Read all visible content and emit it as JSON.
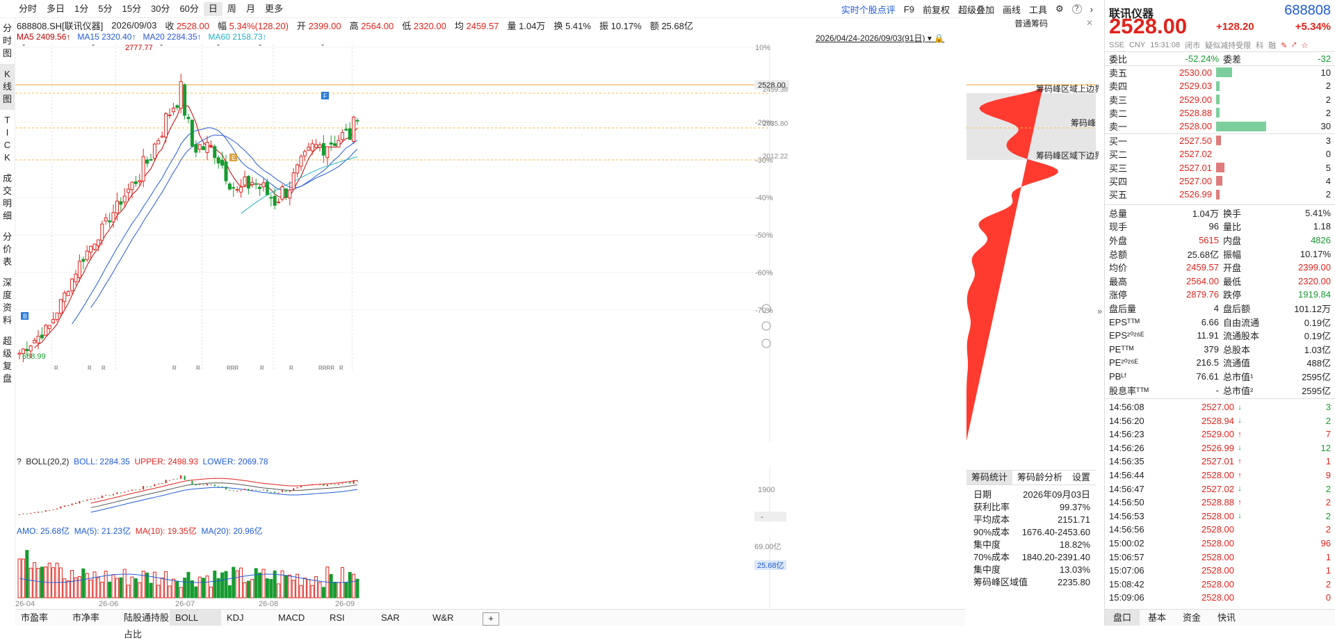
{
  "periods": [
    "分时",
    "多日",
    "1分",
    "5分",
    "15分",
    "30分",
    "60分",
    "日",
    "周",
    "月",
    "更多"
  ],
  "active_period": "日",
  "toolbar_right": {
    "rating": "实时个股点评",
    "f9": "F9",
    "adjust": "前复权",
    "overlay": "超级叠加",
    "draw": "画线",
    "tools": "工具"
  },
  "info": {
    "code_name": "688808.SH[联讯仪器]",
    "date": "2026/09/03",
    "close_label": "收",
    "close": "2528.00",
    "change_label": "幅",
    "change": "5.34%(128.20)",
    "open_label": "开",
    "open": "2399.00",
    "high_label": "高",
    "high": "2564.00",
    "low_label": "低",
    "low": "2320.00",
    "avg_label": "均",
    "avg": "2459.57",
    "vol_label": "量",
    "vol": "1.04万",
    "turn_label": "换",
    "turn": "5.41%",
    "amp_label": "振",
    "amp": "10.17%",
    "amt_label": "额",
    "amt": "25.68亿"
  },
  "ma": {
    "ma5": "MA5 2409.56↑",
    "ma15": "MA15 2320.40↑",
    "ma20": "MA20 2284.35↑",
    "ma60": "MA60 2158.73↑"
  },
  "date_range": "2026/04/24-2026/09/03(91日)",
  "vmenu": [
    {
      "label": "分\n时\n图"
    },
    {
      "label": "K\n线\n图"
    },
    {
      "label": "T\nI\nC\nK"
    },
    {
      "label": "成\n交\n明\n细"
    },
    {
      "label": "分\n价\n表"
    },
    {
      "label": "深\n度\n资\n料"
    },
    {
      "label": "超\n级\n复\n盘"
    }
  ],
  "axis": {
    "pct": [
      "10%",
      "-10%",
      "-20%",
      "-30%",
      "-40%",
      "-50%",
      "-60%",
      "-70%"
    ],
    "price_tag": "2528.00",
    "p1": "2459.38",
    "p2": "2035.80",
    "p3": "2012.22",
    "boll_tick": "1900",
    "boll_dash": "-",
    "vol_tick": "69.00亿",
    "vol_tag": "25.68亿",
    "months": [
      "26-04",
      "26-06",
      "26-07",
      "26-08",
      "26-09"
    ]
  },
  "annotations": {
    "high": "2777.77",
    "low": "688.99",
    "marker_b": "B",
    "marker_f": "F",
    "marker_e": "E",
    "r": "R",
    "rrr": "RRR",
    "rrrr": "RRRR"
  },
  "boll": {
    "title": "BOLL(20,2)",
    "boll": "BOLL: 2284.35",
    "upper": "UPPER: 2498.93",
    "lower": "LOWER: 2069.78",
    "q": "?"
  },
  "amo": {
    "amo": "AMO: 25.68亿",
    "ma5": "MA(5): 21.23亿",
    "ma10": "MA(10): 19.35亿",
    "ma20": "MA(20): 20.96亿"
  },
  "bottom_tabs": [
    "市盈率",
    "市净率",
    "陆股通持股占比",
    "BOLL",
    "KDJ",
    "MACD",
    "RSI",
    "SAR",
    "W&R",
    "+"
  ],
  "active_bottom_tab": "BOLL",
  "chip": {
    "header": "普通筹码",
    "upper": "筹码峰区域上边界",
    "peak": "筹码峰",
    "lower": "筹码峰区域下边界",
    "tabs": [
      "筹码统计",
      "筹码龄分析",
      "设置"
    ],
    "stats": [
      {
        "k": "日期",
        "v": "2026年09月03日"
      },
      {
        "k": "获利比率",
        "v": "99.37%"
      },
      {
        "k": "平均成本",
        "v": "2151.71"
      },
      {
        "k": "90%成本",
        "v": "1676.40-2453.60"
      },
      {
        "k": "集中度",
        "v": "18.82%"
      },
      {
        "k": "70%成本",
        "v": "1840.20-2391.40"
      },
      {
        "k": "集中度",
        "v": "13.03%"
      },
      {
        "k": "筹码峰区域值",
        "v": "2235.80"
      }
    ]
  },
  "quote": {
    "name": "联讯仪器",
    "code": "688808",
    "price": "2528.00",
    "change": "+128.20",
    "pct": "+5.34%",
    "sub": [
      "SSE",
      "CNY",
      "15:31:08",
      "闭市",
      "疑似减持受限",
      "科",
      "融"
    ],
    "wb": {
      "l1": "委比",
      "v1": "-52.24%",
      "l2": "委差",
      "v2": "-32"
    },
    "asks": [
      {
        "lab": "卖五",
        "p": "2530.00",
        "q": "10",
        "w": 0.18
      },
      {
        "lab": "卖四",
        "p": "2529.03",
        "q": "2",
        "w": 0.04
      },
      {
        "lab": "卖三",
        "p": "2529.00",
        "q": "2",
        "w": 0.04
      },
      {
        "lab": "卖二",
        "p": "2528.88",
        "q": "2",
        "w": 0.04
      },
      {
        "lab": "卖一",
        "p": "2528.00",
        "q": "30",
        "w": 0.55
      }
    ],
    "bids": [
      {
        "lab": "买一",
        "p": "2527.50",
        "q": "3",
        "w": 0.05
      },
      {
        "lab": "买二",
        "p": "2527.02",
        "q": "0",
        "w": 0.0
      },
      {
        "lab": "买三",
        "p": "2527.01",
        "q": "5",
        "w": 0.09
      },
      {
        "lab": "买四",
        "p": "2527.00",
        "q": "4",
        "w": 0.07
      },
      {
        "lab": "买五",
        "p": "2526.99",
        "q": "2",
        "w": 0.04
      }
    ],
    "stats": [
      {
        "l1": "总量",
        "v1": "1.04万",
        "c1": "",
        "l2": "换手",
        "v2": "5.41%",
        "c2": ""
      },
      {
        "l1": "现手",
        "v1": "96",
        "c1": "",
        "l2": "量比",
        "v2": "1.18",
        "c2": ""
      },
      {
        "l1": "外盘",
        "v1": "5615",
        "c1": "red",
        "l2": "内盘",
        "v2": "4826",
        "c2": "green"
      },
      {
        "l1": "总额",
        "v1": "25.68亿",
        "c1": "",
        "l2": "振幅",
        "v2": "10.17%",
        "c2": ""
      },
      {
        "l1": "均价",
        "v1": "2459.57",
        "c1": "red",
        "l2": "开盘",
        "v2": "2399.00",
        "c2": "red"
      },
      {
        "l1": "最高",
        "v1": "2564.00",
        "c1": "red",
        "l2": "最低",
        "v2": "2320.00",
        "c2": "red"
      },
      {
        "l1": "涨停",
        "v1": "2879.76",
        "c1": "red",
        "l2": "跌停",
        "v2": "1919.84",
        "c2": "green"
      },
      {
        "l1": "盘后量",
        "v1": "4",
        "c1": "",
        "l2": "盘后额",
        "v2": "101.12万",
        "c2": ""
      },
      {
        "l1": "EPSᵀᵀᴹ",
        "v1": "6.66",
        "c1": "",
        "l2": "自由流通",
        "v2": "0.19亿",
        "c2": ""
      },
      {
        "l1": "EPS²⁰²⁶ᴱ",
        "v1": "11.91",
        "c1": "",
        "l2": "流通股本",
        "v2": "0.19亿",
        "c2": ""
      },
      {
        "l1": "PEᵀᵀᴹ",
        "v1": "379",
        "c1": "",
        "l2": "总股本",
        "v2": "1.03亿",
        "c2": ""
      },
      {
        "l1": "PE²⁰²⁶ᴱ",
        "v1": "216.5",
        "c1": "",
        "l2": "流通值",
        "v2": "488亿",
        "c2": ""
      },
      {
        "l1": "PBᴸᶠ",
        "v1": "76.61",
        "c1": "",
        "l2": "总市值¹",
        "v2": "2595亿",
        "c2": ""
      },
      {
        "l1": "股息率ᵀᵀᴹ",
        "v1": "-",
        "c1": "",
        "l2": "总市值²",
        "v2": "2595亿",
        "c2": ""
      }
    ],
    "ticks": [
      {
        "t": "14:56:08",
        "p": "2527.00",
        "d": "down",
        "q": "3"
      },
      {
        "t": "14:56:20",
        "p": "2528.94",
        "d": "down",
        "q": "2"
      },
      {
        "t": "14:56:23",
        "p": "2529.00",
        "d": "up",
        "q": "7"
      },
      {
        "t": "14:56:26",
        "p": "2526.99",
        "d": "down",
        "q": "12"
      },
      {
        "t": "14:56:35",
        "p": "2527.01",
        "d": "up",
        "q": "1"
      },
      {
        "t": "14:56:44",
        "p": "2528.00",
        "d": "up",
        "q": "9"
      },
      {
        "t": "14:56:47",
        "p": "2527.02",
        "d": "down",
        "q": "2"
      },
      {
        "t": "14:56:50",
        "p": "2528.88",
        "d": "up",
        "q": "2"
      },
      {
        "t": "14:56:53",
        "p": "2528.00",
        "d": "down",
        "q": "2"
      },
      {
        "t": "14:56:56",
        "p": "2528.00",
        "d": "",
        "q": "2"
      },
      {
        "t": "15:00:02",
        "p": "2528.00",
        "d": "",
        "q": "96"
      },
      {
        "t": "15:06:57",
        "p": "2528.00",
        "d": "",
        "q": "1"
      },
      {
        "t": "15:07:06",
        "p": "2528.00",
        "d": "",
        "q": "1"
      },
      {
        "t": "15:08:42",
        "p": "2528.00",
        "d": "",
        "q": "2"
      },
      {
        "t": "15:09:06",
        "p": "2528.00",
        "d": "",
        "q": "0"
      }
    ],
    "tabs": [
      "盘口",
      "基本",
      "资金",
      "快讯"
    ]
  },
  "colors": {
    "up": "#e0231c",
    "down": "#169b30",
    "ma5": "#c00000",
    "ma15": "#1e5bd9",
    "ma20": "#2a58d8",
    "ma60": "#25b2c6",
    "priceline": "#f0a030",
    "chip": "#ff3b30"
  }
}
